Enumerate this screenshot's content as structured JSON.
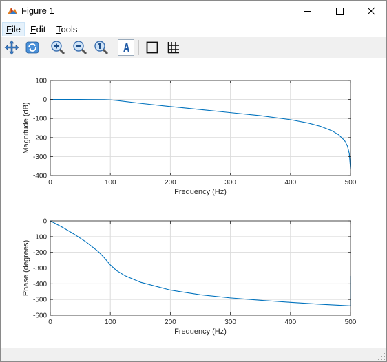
{
  "window": {
    "title": "Figure 1"
  },
  "icons": {
    "app": "matlab-figure-icon",
    "minimize": "minimize-icon",
    "maximize": "maximize-icon",
    "close": "close-icon",
    "pan": "pan-icon",
    "rotate": "rotate-3d-icon",
    "zoom_in": "zoom-in-icon",
    "zoom_out": "zoom-out-icon",
    "zoom_reset": "zoom-reset-icon",
    "edit_plot": "edit-plot-icon",
    "box": "box-icon",
    "grid": "grid-icon"
  },
  "menu": [
    {
      "accel": "F",
      "rest": "ile"
    },
    {
      "accel": "E",
      "rest": "dit"
    },
    {
      "accel": "T",
      "rest": "ools"
    }
  ],
  "colors": {
    "line": "#0072bd",
    "grid": "#dcdcdc",
    "axis": "#262626",
    "toolbar_bg": "#f0f0f0"
  },
  "chart_data": [
    {
      "type": "line",
      "title": "",
      "xlabel": "Frequency (Hz)",
      "ylabel": "Magnitude (dB)",
      "xlim": [
        0,
        500
      ],
      "ylim": [
        -400,
        100
      ],
      "xticks": [
        0,
        100,
        200,
        300,
        400,
        500
      ],
      "yticks": [
        100,
        0,
        -100,
        -200,
        -300,
        -400
      ],
      "grid": true,
      "series": [
        {
          "x": [
            0,
            50,
            90,
            100,
            110,
            150,
            200,
            250,
            300,
            350,
            400,
            430,
            450,
            470,
            480,
            490,
            495,
            498,
            500
          ],
          "y": [
            0,
            0,
            -0.5,
            -2,
            -5,
            -20,
            -37,
            -53,
            -69,
            -85,
            -106,
            -124,
            -141,
            -166,
            -185,
            -215,
            -245,
            -285,
            -365
          ]
        }
      ]
    },
    {
      "type": "line",
      "title": "",
      "xlabel": "Frequency (Hz)",
      "ylabel": "Phase (degrees)",
      "xlim": [
        0,
        500
      ],
      "ylim": [
        -600,
        0
      ],
      "xticks": [
        0,
        100,
        200,
        300,
        400,
        500
      ],
      "yticks": [
        0,
        -100,
        -200,
        -300,
        -400,
        -500,
        -600
      ],
      "grid": true,
      "series": [
        {
          "x": [
            0,
            20,
            40,
            60,
            80,
            90,
            100,
            110,
            125,
            150,
            200,
            250,
            300,
            350,
            400,
            450,
            499.5,
            500,
            500
          ],
          "y": [
            0,
            -40,
            -85,
            -135,
            -195,
            -235,
            -280,
            -315,
            -350,
            -390,
            -440,
            -470,
            -490,
            -505,
            -518,
            -530,
            -540,
            -540,
            -350
          ]
        }
      ]
    }
  ]
}
